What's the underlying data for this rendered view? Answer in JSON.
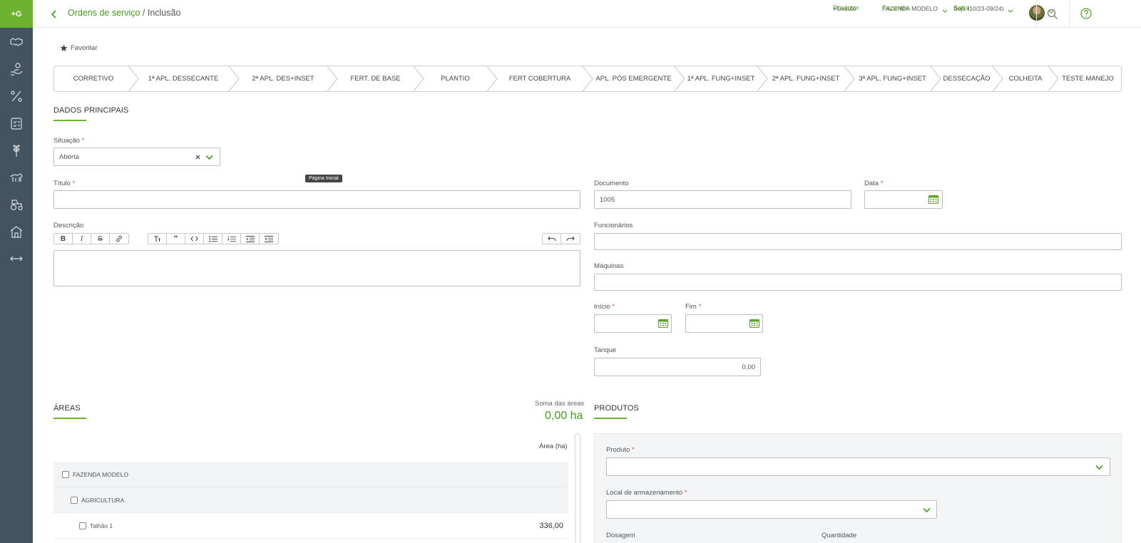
{
  "app": {
    "logo": "+G"
  },
  "sidebar": {
    "icons": [
      "handshake-icon",
      "hand-money-icon",
      "percent-icon",
      "checklist-icon",
      "wheat-icon",
      "farm-animal-icon",
      "tractor-icon",
      "home-icon",
      "expand-icon"
    ]
  },
  "header": {
    "breadcrumb_link": "Ordens de serviço",
    "breadcrumb_sep": " / ",
    "breadcrumb_current": "Inclusão",
    "produtor_label": "Produtor",
    "produtor_value": "+Gestão",
    "fazenda_label": "Fazenda",
    "fazenda_value": "FAZENDA MODELO",
    "safra_label": "Safra",
    "safra_value": "Soja (10/23-09/24)"
  },
  "favorite": {
    "label": "Favoritar"
  },
  "steps": [
    "CORRETIVO",
    "1ª APL. DESSECANTE",
    "2ª APL. DES+INSET",
    "FERT. DE BASE",
    "PLANTIO",
    "FERT COBERTURA",
    "APL. PÓS EMERGENTE",
    "1ª APL. FUNG+INSET",
    "2ª APL. FUNG+INSET",
    "3ª APL. FUNG+INSET",
    "DESSECAÇÃO",
    "COLHEITA",
    "TESTE MANEJO"
  ],
  "dados": {
    "title": "DADOS PRINCIPAIS",
    "situacao_label": "Situação",
    "situacao_value": "Aberta",
    "titulo_label": "Título",
    "titulo_value": "",
    "documento_label": "Documento",
    "documento_value": "1005",
    "data_label": "Data",
    "descricao_label": "Descrição",
    "funcionarios_label": "Funcionários",
    "maquinas_label": "Máquinas",
    "inicio_label": "Início",
    "fim_label": "Fim",
    "tanque_label": "Tanque",
    "tanque_value": "0,00",
    "required_mark": "*",
    "tooltip": "Página Inicial"
  },
  "editor_toolbar": {
    "format": [
      "bold",
      "italic",
      "strikethrough",
      "link"
    ],
    "blocks": [
      "heading",
      "quote",
      "code",
      "bulleted-list",
      "numbered-list",
      "outdent",
      "indent"
    ],
    "history": [
      "undo",
      "redo"
    ]
  },
  "areas": {
    "title": "ÁREAS",
    "soma_label": "Soma das áreas",
    "soma_value": "0,00 ha",
    "column_header": "Área (ha)",
    "rows": [
      {
        "label": "FAZENDA MODELO",
        "value": ""
      },
      {
        "label": "AGRICULTURA",
        "value": ""
      },
      {
        "label": "Talhão 1",
        "value": "336,00"
      }
    ]
  },
  "produtos": {
    "title": "PRODUTOS",
    "produto_label": "Produto",
    "local_label": "Local de armazenamento",
    "dosagem_label": "Dosagem",
    "quantidade_label": "Quantidade"
  },
  "colors": {
    "accent": "#6cb22f",
    "sidebar": "#435360",
    "required": "#d9534f"
  }
}
